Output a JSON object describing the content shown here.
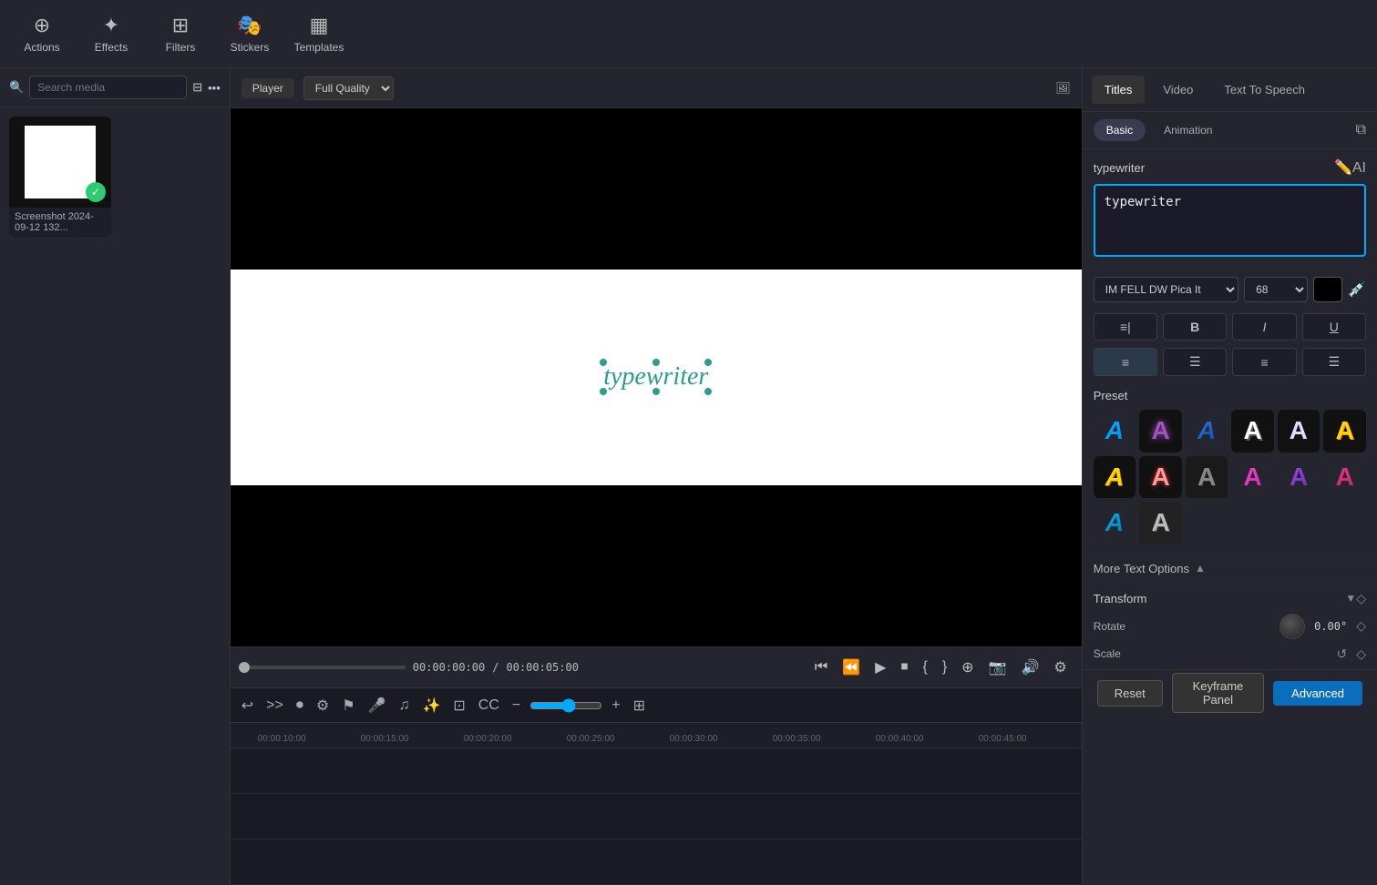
{
  "toolbar": {
    "items": [
      {
        "id": "effects",
        "label": "Effects",
        "icon": "✦"
      },
      {
        "id": "filters",
        "label": "Filters",
        "icon": "⊞"
      },
      {
        "id": "stickers",
        "label": "Stickers",
        "icon": "😊"
      },
      {
        "id": "templates",
        "label": "Templates",
        "icon": "▦"
      }
    ]
  },
  "search": {
    "placeholder": "Search media"
  },
  "player": {
    "label": "Player",
    "quality": "Full Quality",
    "current_time": "00:00:00:00",
    "total_time": "00:00:05:00"
  },
  "media": {
    "items": [
      {
        "label": "Screenshot 2024-09-12 132...",
        "checked": true
      }
    ]
  },
  "canvas": {
    "text": "typewriter"
  },
  "right_panel": {
    "tabs": [
      "Titles",
      "Video",
      "Text To Speech"
    ],
    "active_tab": "Titles",
    "sub_tabs": [
      "Basic",
      "Animation"
    ],
    "active_sub_tab": "Basic",
    "text_title": "typewriter",
    "text_content": "typewriter",
    "font_family": "IM FELL DW Pica It",
    "font_size": "68",
    "preset_label": "Preset",
    "presets": [
      {
        "id": "p1",
        "bg": "#111",
        "text": "A",
        "gradient": "linear-gradient(135deg, #00bfff, #007fff)",
        "color": "#00bfff"
      },
      {
        "id": "p2",
        "bg": "#111",
        "text": "A",
        "gradient": "linear-gradient(135deg, #9b59b6, #6a0080)",
        "color": "#9b59b6"
      },
      {
        "id": "p3",
        "bg": "#111",
        "text": "A",
        "gradient": "linear-gradient(135deg, #3a86ff, #023e8a)",
        "color": "#3a86ff"
      },
      {
        "id": "p4",
        "bg": "#111",
        "text": "A",
        "gradient": "linear-gradient(135deg, #ffffff, #aaaaaa)",
        "color": "#fff"
      },
      {
        "id": "p5",
        "bg": "#111",
        "text": "A",
        "gradient": "linear-gradient(135deg, #ffffff, #6699cc)",
        "color": "#ddf"
      },
      {
        "id": "p6",
        "bg": "#111",
        "text": "A",
        "gradient": "linear-gradient(135deg, #ffd700, #ff8c00)",
        "color": "#ffd700"
      },
      {
        "id": "p7",
        "bg": "#111",
        "text": "A",
        "gradient": "linear-gradient(135deg, #ffd700, #aa6600)",
        "color": "#ffd700"
      },
      {
        "id": "p8",
        "bg": "#111",
        "text": "A",
        "gradient": "linear-gradient(135deg, #ff9999, #cc3333)",
        "color": "#ff9999"
      },
      {
        "id": "p9",
        "bg": "#111",
        "text": "A",
        "gradient": "linear-gradient(135deg, #888, #333)",
        "color": "#999"
      },
      {
        "id": "p10",
        "bg": "#111",
        "text": "A",
        "gradient": "linear-gradient(135deg, #ff69b4, #cc00cc)",
        "color": "#ff69b4"
      },
      {
        "id": "p11",
        "bg": "#111",
        "text": "A",
        "gradient": "linear-gradient(135deg, #a855f7, #6b21a8)",
        "color": "#a855f7"
      },
      {
        "id": "p12",
        "bg": "#111",
        "text": "A",
        "gradient": "linear-gradient(135deg, #ec4899, #be185d)",
        "color": "#ec4899"
      },
      {
        "id": "p13",
        "bg": "#111",
        "text": "A",
        "gradient": "linear-gradient(135deg, #00cfff, #0060aa)",
        "color": "#00cfff"
      },
      {
        "id": "p14",
        "bg": "#111",
        "text": "A",
        "gradient": "linear-gradient(135deg, #aaaaaa, #555555)",
        "color": "#aaa"
      }
    ],
    "more_text_options": "More Text Options",
    "transform_label": "Transform",
    "rotate_label": "Rotate",
    "rotate_value": "0.00°",
    "scale_label": "Scale"
  },
  "bottom_bar": {
    "reset_label": "Reset",
    "keyframe_label": "Keyframe Panel",
    "advanced_label": "Advanced"
  },
  "timeline": {
    "marks": [
      "00:00:10:00",
      "00:00:15:00",
      "00:00:20:00",
      "00:00:25:00",
      "00:00:30:00",
      "00:00:35:00",
      "00:00:40:00",
      "00:00:45:00"
    ]
  }
}
